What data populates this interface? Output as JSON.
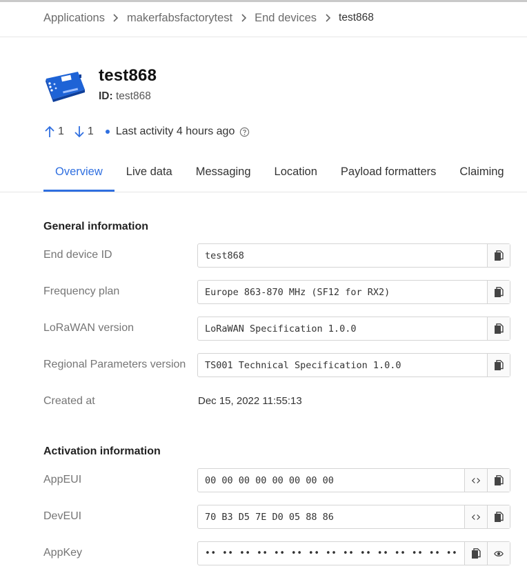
{
  "breadcrumb": {
    "items": [
      "Applications",
      "makerfabsfactorytest",
      "End devices",
      "test868"
    ]
  },
  "device": {
    "title": "test868",
    "id_label": "ID:",
    "id_value": "test868"
  },
  "stats": {
    "uplink_count": "1",
    "downlink_count": "1",
    "last_activity": "Last activity 4 hours ago"
  },
  "tabs": [
    "Overview",
    "Live data",
    "Messaging",
    "Location",
    "Payload formatters",
    "Claiming"
  ],
  "active_tab": "Overview",
  "general": {
    "title": "General information",
    "end_device_id": {
      "label": "End device ID",
      "value": "test868"
    },
    "frequency_plan": {
      "label": "Frequency plan",
      "value": "Europe 863-870 MHz (SF12 for RX2)"
    },
    "lorawan_version": {
      "label": "LoRaWAN version",
      "value": "LoRaWAN Specification 1.0.0"
    },
    "regional_params": {
      "label": "Regional Parameters version",
      "value": "TS001 Technical Specification 1.0.0"
    },
    "created_at": {
      "label": "Created at",
      "value": "Dec 15, 2022 11:55:13"
    }
  },
  "activation": {
    "title": "Activation information",
    "app_eui": {
      "label": "AppEUI",
      "value": "00 00 00 00 00 00 00 00"
    },
    "dev_eui": {
      "label": "DevEUI",
      "value": "70 B3 D5 7E D0 05 88 86"
    },
    "app_key": {
      "label": "AppKey",
      "value": "•• •• •• •• •• •• •• •• •• •• •• •• •• •• •• ••"
    }
  },
  "icons": {
    "copy": "copy-icon",
    "code": "code-toggle-icon",
    "eye": "eye-icon",
    "uplink": "arrow-up-icon",
    "downlink": "arrow-down-icon",
    "help": "help-circle-icon",
    "chevron": "chevron-right-icon"
  },
  "colors": {
    "accent": "#2f6fe0",
    "device_icon": "#1e63d6"
  }
}
